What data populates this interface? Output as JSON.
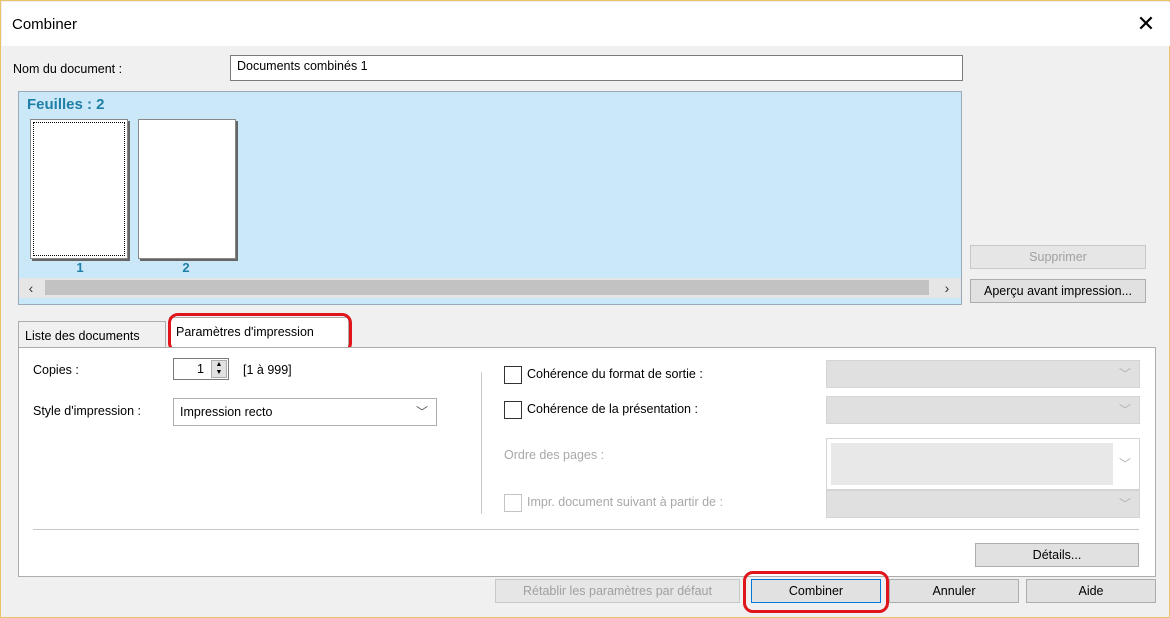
{
  "window": {
    "title": "Combiner",
    "close": "✕"
  },
  "doc": {
    "label": "Nom du document :",
    "value": "Documents combinés 1"
  },
  "sheets": {
    "title": "Feuilles : 2",
    "items": [
      "1",
      "2"
    ],
    "scroll_left": "‹",
    "scroll_right": "›"
  },
  "side": {
    "delete": "Supprimer",
    "preview": "Aperçu avant impression..."
  },
  "tabs": [
    {
      "label": "Liste des documents"
    },
    {
      "label": "Paramètres d'impression"
    }
  ],
  "print": {
    "copies_label": "Copies :",
    "copies_value": "1",
    "copies_range": "[1 à 999]",
    "style_label": "Style d'impression :",
    "style_value": "Impression recto",
    "output_format": "Cohérence du format de sortie :",
    "presentation": "Cohérence de la présentation :",
    "page_order": "Ordre des pages :",
    "next_doc": "Impr. document suivant à partir de :",
    "details": "Détails..."
  },
  "footer": {
    "reset": "Rétablir les paramètres par défaut",
    "combine": "Combiner",
    "cancel": "Annuler",
    "help": "Aide"
  },
  "icons": {
    "dropdown": "chevron-down-icon",
    "spinner": "spinner-icon",
    "close": "close-icon"
  },
  "colors": {
    "accent": "#1f7fa6",
    "highlight": "#e0141b",
    "pane": "#cbe8f8"
  }
}
